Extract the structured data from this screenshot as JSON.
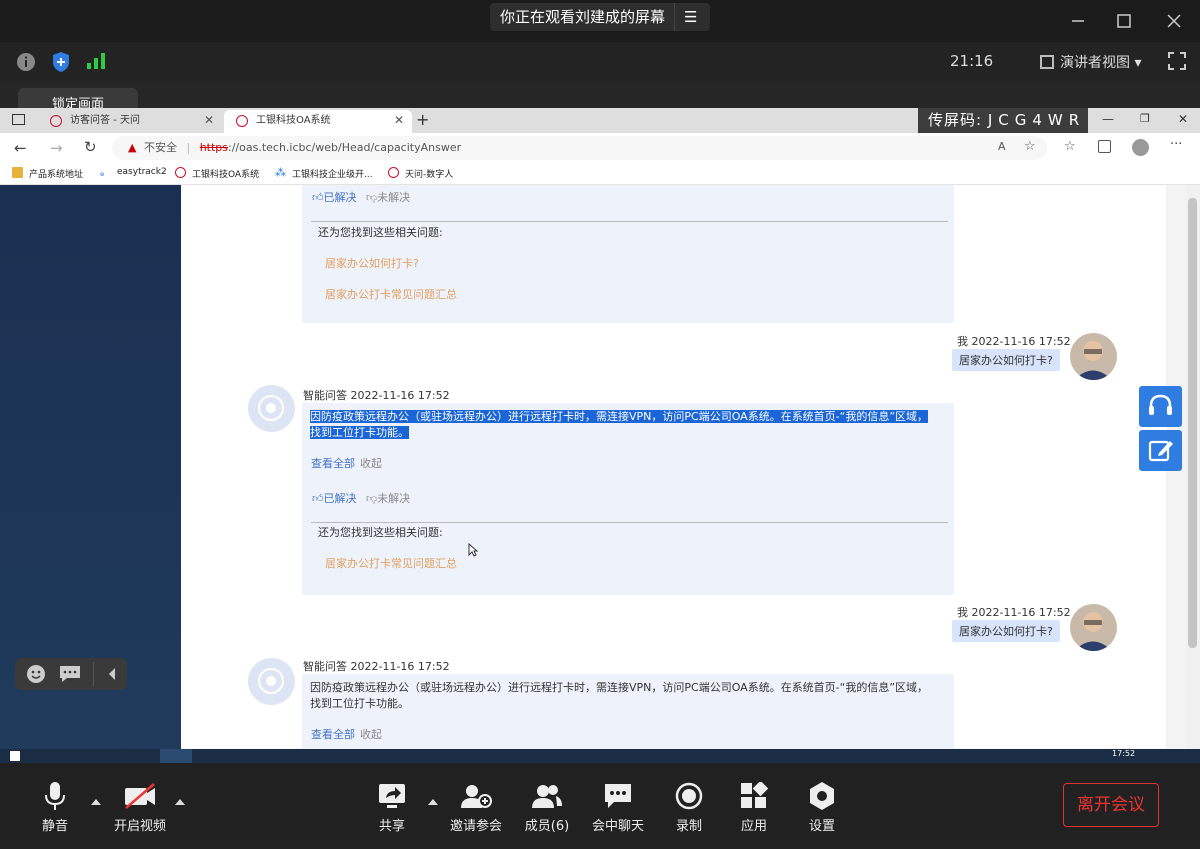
{
  "meeting": {
    "share_status": "你正在观看刘建成的屏幕",
    "clock": "21:16",
    "view_mode": "演讲者视图",
    "lock_label": "锁定画面",
    "share_code_label": "传屏码:",
    "share_code": "JCG4WR"
  },
  "browser": {
    "tabs": [
      {
        "label": "访客问答 - 天问"
      },
      {
        "label": "工银科技OA系统"
      }
    ],
    "insecure_label": "不安全",
    "url_scheme": "https",
    "url_rest": "://oas.tech.icbc/web/Head/capacityAnswer",
    "bookmarks": [
      {
        "label": "产品系统地址"
      },
      {
        "label": "easytrack2"
      },
      {
        "label": "工银科技OA系统"
      },
      {
        "label": "工银科技企业级开..."
      },
      {
        "label": "天问-数字人"
      }
    ]
  },
  "chat": {
    "feedback_yes": "已解决",
    "feedback_no": "未解决",
    "related_title": "还为您找到这些相关问题:",
    "first_card_suggestions": [
      "居家办公如何打卡?",
      "居家办公打卡常见问题汇总"
    ],
    "user_messages": [
      {
        "meta": "我 2022-11-16 17:52",
        "text": "居家办公如何打卡?"
      },
      {
        "meta": "我 2022-11-16 17:52",
        "text": "居家办公如何打卡?"
      }
    ],
    "bot_messages": [
      {
        "meta": "智能问答 2022-11-16 17:52",
        "text_line1": "因防疫政策远程办公（或驻场远程办公）进行远程打卡时，需连接VPN，访问PC端公司OA系统。在系统首页-“我的信息”区域，",
        "text_line2": "找到工位打卡功能。",
        "view_all": "查看全部",
        "fold": "收起",
        "suggestions": [
          "居家办公打卡常见问题汇总"
        ]
      },
      {
        "meta": "智能问答 2022-11-16 17:52",
        "text_line1": "因防疫政策远程办公（或驻场远程办公）进行远程打卡时，需连接VPN，访问PC端公司OA系统。在系统首页-“我的信息”区域，",
        "text_line2": "找到工位打卡功能。",
        "view_all": "查看全部",
        "fold": "收起"
      }
    ]
  },
  "taskbar_time": "17:52",
  "toolbar": {
    "mute": "静音",
    "video": "开启视频",
    "share": "共享",
    "invite": "邀请参会",
    "members": "成员(6)",
    "chat": "会中聊天",
    "record": "录制",
    "apps": "应用",
    "settings": "设置",
    "leave": "离开会议"
  },
  "colors": {
    "accent": "#2f7de1",
    "leave": "#e33333",
    "selection": "#1c65d6"
  }
}
